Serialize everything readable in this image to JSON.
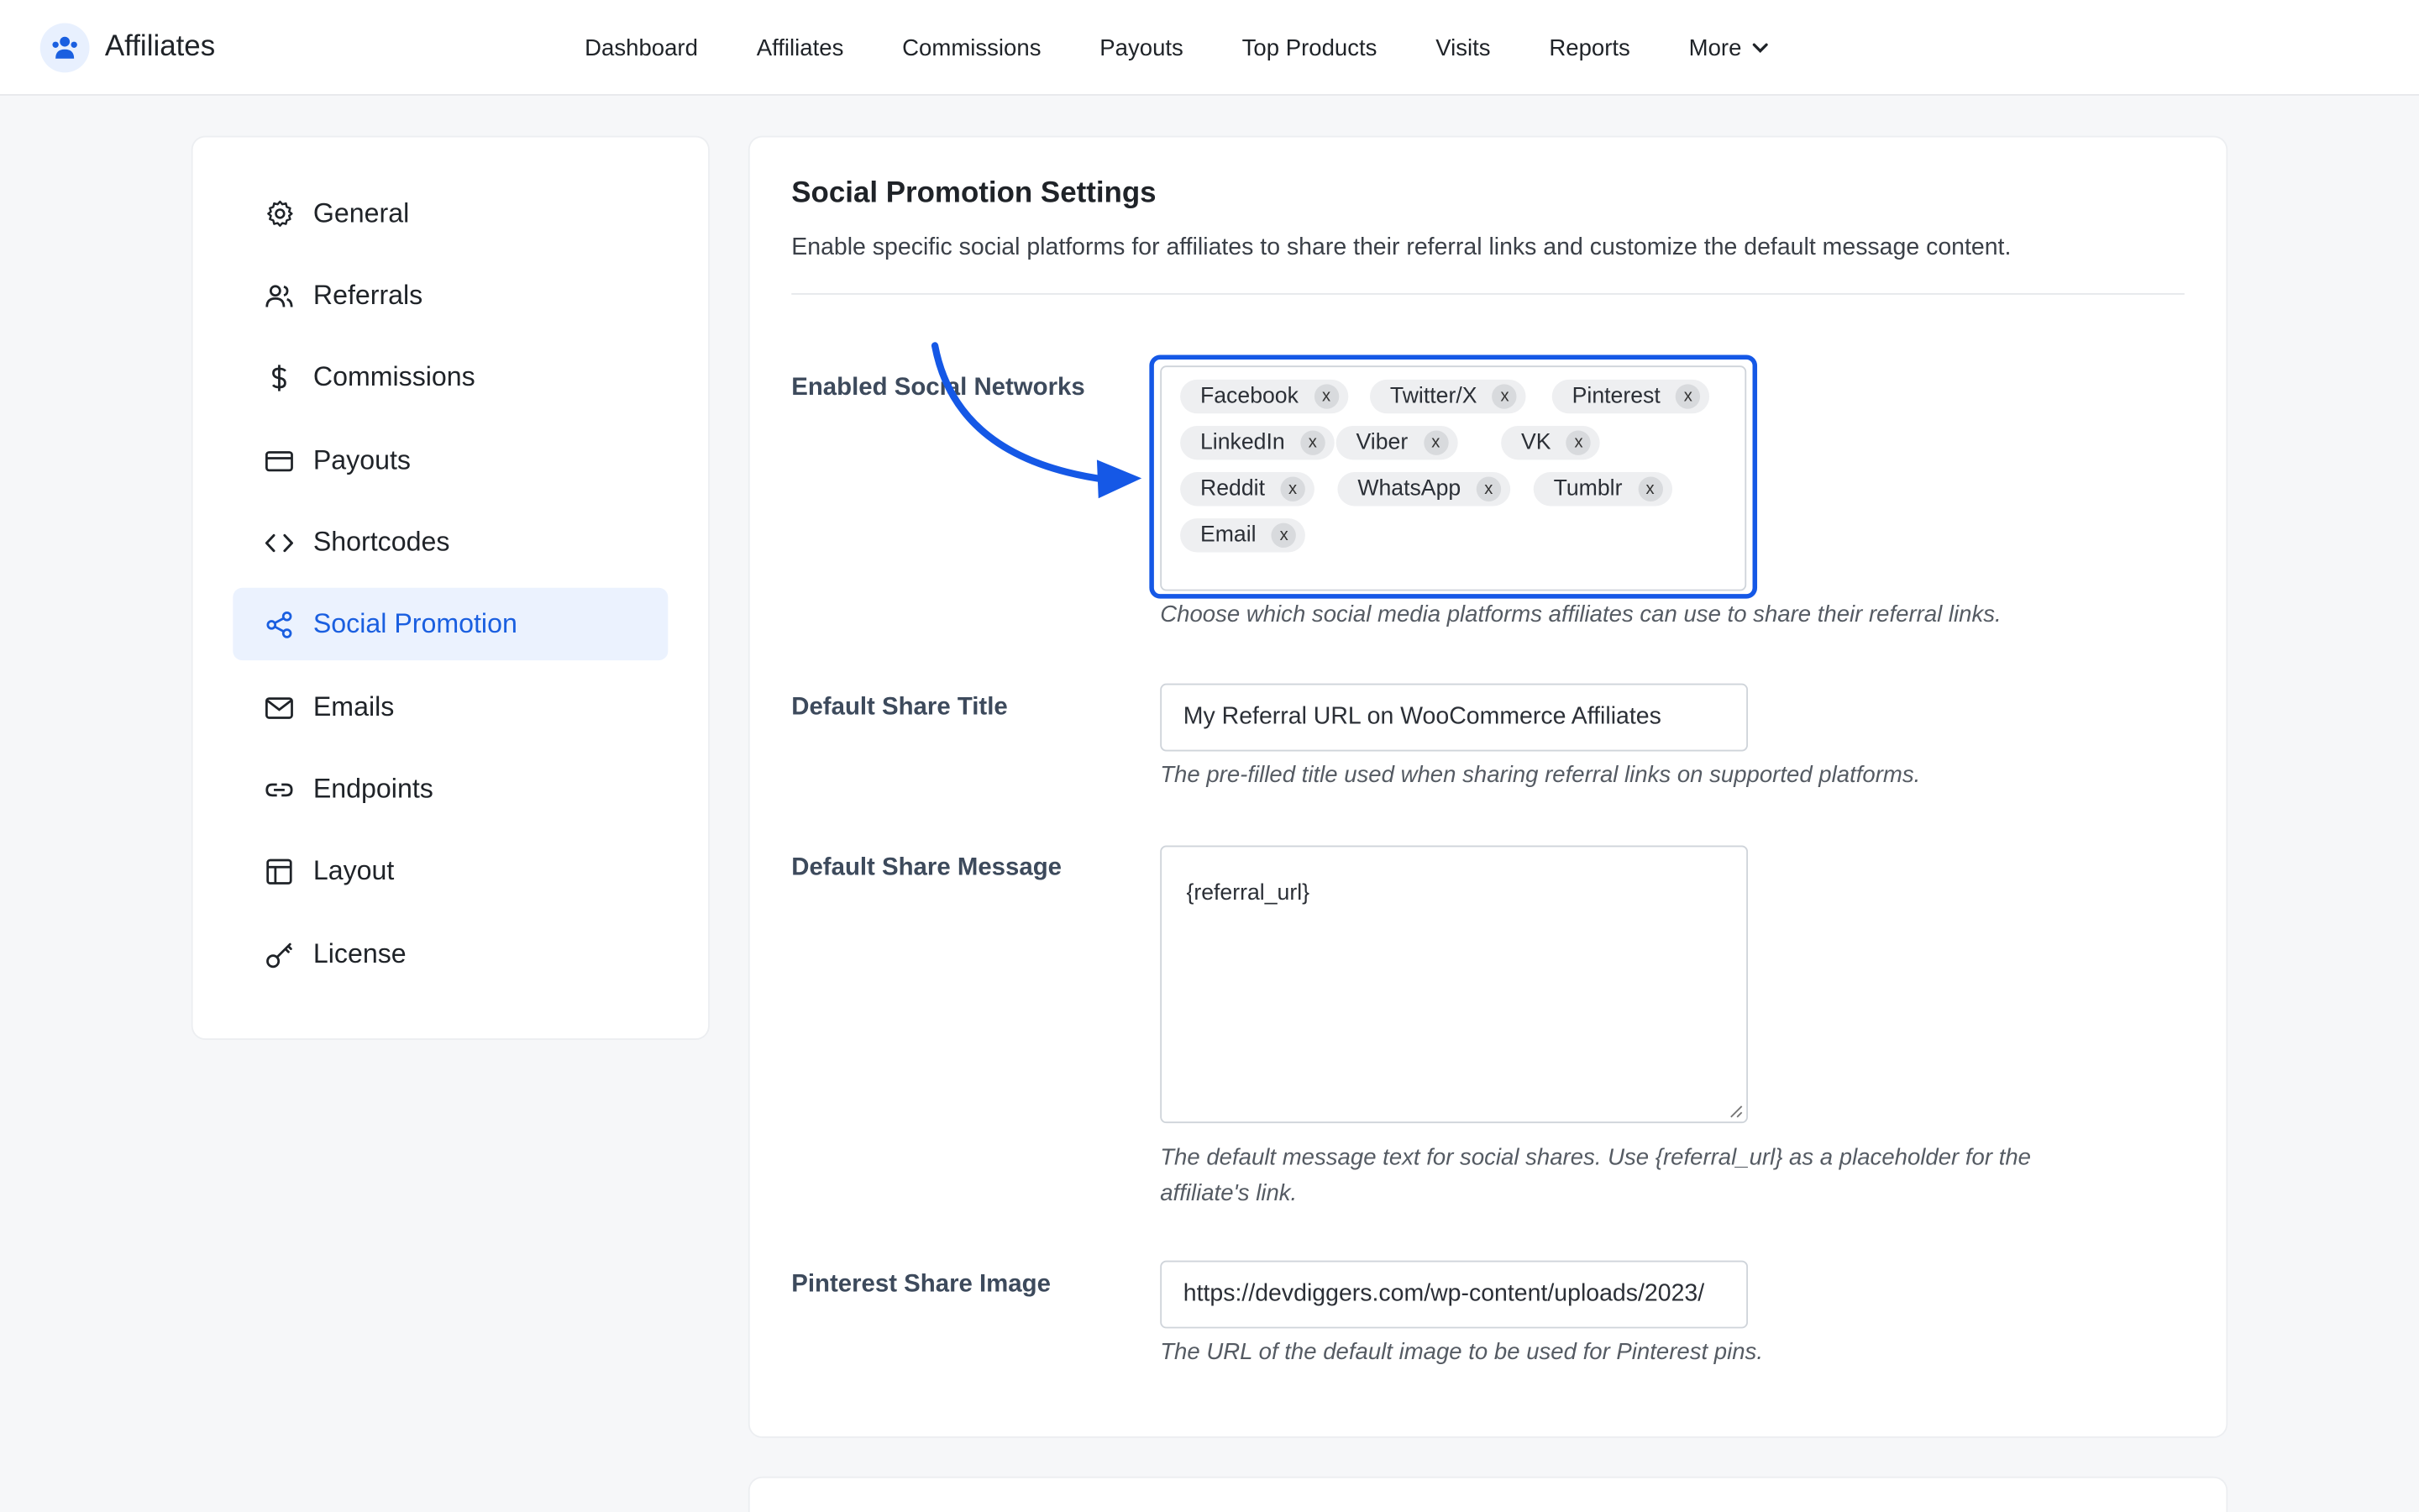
{
  "app": {
    "name": "Affiliates",
    "logo_icon": "affiliate-people-icon"
  },
  "topnav": {
    "items": [
      "Dashboard",
      "Affiliates",
      "Commissions",
      "Payouts",
      "Top Products",
      "Visits",
      "Reports"
    ],
    "more_label": "More"
  },
  "sidebar": {
    "items": [
      {
        "label": "General",
        "icon": "gear-icon"
      },
      {
        "label": "Referrals",
        "icon": "users-icon"
      },
      {
        "label": "Commissions",
        "icon": "dollar-icon"
      },
      {
        "label": "Payouts",
        "icon": "credit-card-icon"
      },
      {
        "label": "Shortcodes",
        "icon": "code-icon"
      },
      {
        "label": "Social Promotion",
        "icon": "share-icon",
        "active": true
      },
      {
        "label": "Emails",
        "icon": "mail-icon"
      },
      {
        "label": "Endpoints",
        "icon": "link-icon"
      },
      {
        "label": "Layout",
        "icon": "layout-icon"
      },
      {
        "label": "License",
        "icon": "key-icon"
      }
    ]
  },
  "main": {
    "title": "Social Promotion Settings",
    "description": "Enable specific social platforms for affiliates to share their referral links and customize the default message content.",
    "enabled_networks": {
      "label": "Enabled Social Networks",
      "tags": [
        "Facebook",
        "Twitter/X",
        "Pinterest",
        "LinkedIn",
        "Viber",
        "VK",
        "Reddit",
        "WhatsApp",
        "Tumblr",
        "Email"
      ],
      "remove_glyph": "x",
      "help": "Choose which social media platforms affiliates can use to share their referral links."
    },
    "share_title": {
      "label": "Default Share Title",
      "value": "My Referral URL on WooCommerce Affiliates",
      "help": "The pre-filled title used when sharing referral links on supported platforms."
    },
    "share_message": {
      "label": "Default Share Message",
      "value": "{referral_url}",
      "help_line1": "The default message text for social shares. Use {referral_url} as a placeholder for the",
      "help_line2": "affiliate's link."
    },
    "pinterest_image": {
      "label": "Pinterest Share Image",
      "value": "https://devdiggers.com/wp-content/uploads/2023/",
      "help": "The URL of the default image to be used for Pinterest pins."
    }
  },
  "colors": {
    "accent": "#1558e6",
    "active_bg": "#ebf2fe",
    "active_text": "#1a5fe0"
  }
}
